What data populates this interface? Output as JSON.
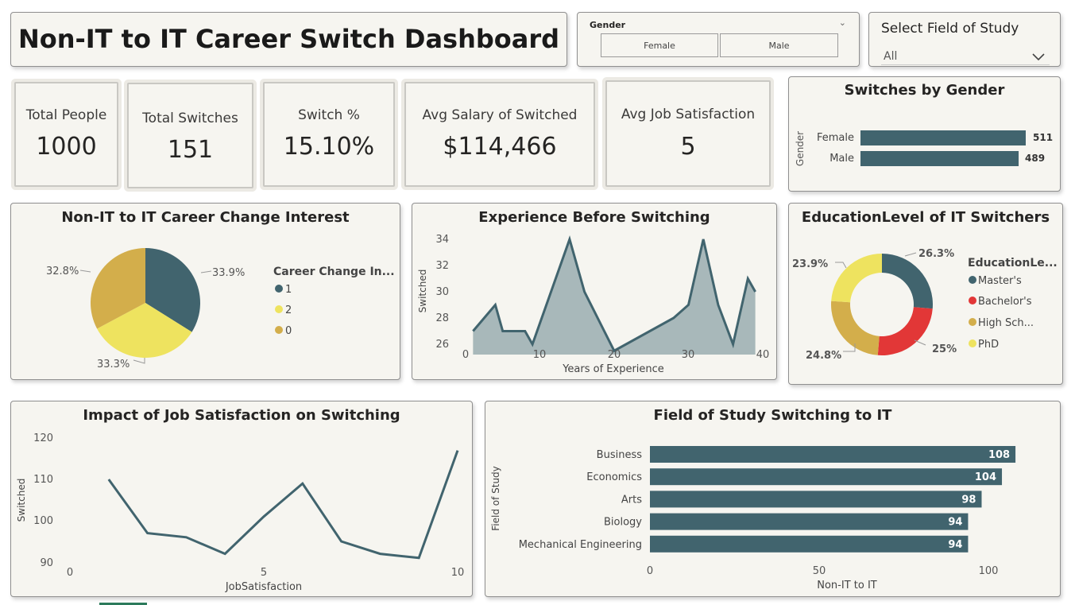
{
  "title": "Non-IT to IT Career Switch Dashboard",
  "gender_slicer": {
    "label": "Gender",
    "options": [
      "Female",
      "Male"
    ]
  },
  "field_slicer": {
    "label": "Select Field of Study",
    "value": "All"
  },
  "kpis": [
    {
      "label": "Total People",
      "value": "1000"
    },
    {
      "label": "Total Switches",
      "value": "151"
    },
    {
      "label": "Switch %",
      "value": "15.10%"
    },
    {
      "label": "Avg Salary of Switched",
      "value": "$114,466"
    },
    {
      "label": "Avg Job Satisfaction",
      "value": "5"
    }
  ],
  "colors": {
    "teal": "#41646e",
    "yellow": "#eee35f",
    "gold": "#d3ae4b",
    "red": "#e23737",
    "area": "#a8b8ba"
  },
  "gender_chart": {
    "title": "Switches by Gender",
    "axis_label": "Gender",
    "chart_data": {
      "type": "bar",
      "categories": [
        "Female",
        "Male"
      ],
      "values": [
        511,
        489
      ],
      "labels": [
        "511",
        "489"
      ]
    }
  },
  "interest_chart": {
    "title": "Non-IT to IT Career Change Interest",
    "legend_title": "Career Change In...",
    "chart_data": {
      "type": "pie",
      "categories": [
        "1",
        "2",
        "0"
      ],
      "values": [
        33.9,
        33.3,
        32.8
      ],
      "labels": [
        "33.9%",
        "33.3%",
        "32.8%"
      ],
      "colors": [
        "#41646e",
        "#eee35f",
        "#d3ae4b"
      ]
    }
  },
  "experience_chart": {
    "title": "Experience Before Switching",
    "xlabel": "Years of Experience",
    "ylabel": "Switched",
    "x_ticks": [
      "0",
      "10",
      "20",
      "30",
      "40"
    ],
    "y_ticks": [
      "26",
      "28",
      "30",
      "32",
      "34"
    ],
    "chart_data": {
      "type": "area",
      "xlim": [
        0,
        40
      ],
      "ylim": [
        26,
        35
      ],
      "x": [
        1,
        4,
        5,
        8,
        9,
        14,
        16,
        20,
        28,
        30,
        32,
        34,
        36,
        38,
        39
      ],
      "y": [
        27,
        29,
        27,
        27,
        26,
        34,
        30,
        25.5,
        28,
        29,
        34,
        29,
        26,
        31,
        30
      ]
    }
  },
  "education_chart": {
    "title": "EducationLevel of IT Switchers",
    "legend_title": "EducationLe...",
    "legend": [
      "Master's",
      "Bachelor's",
      "High Sch...",
      "PhD"
    ],
    "chart_data": {
      "type": "pie",
      "categories": [
        "Master's",
        "Bachelor's",
        "High Sch...",
        "PhD"
      ],
      "values": [
        26.3,
        25,
        24.8,
        23.9
      ],
      "labels": [
        "26.3%",
        "25%",
        "24.8%",
        "23.9%"
      ],
      "colors": [
        "#41646e",
        "#e23737",
        "#d3ae4b",
        "#eee35f"
      ]
    }
  },
  "satisfaction_chart": {
    "title": "Impact of Job Satisfaction on Switching",
    "xlabel": "JobSatisfaction",
    "ylabel": "Switched",
    "x_ticks": [
      "0",
      "5",
      "10"
    ],
    "y_ticks": [
      "90",
      "100",
      "110",
      "120"
    ],
    "chart_data": {
      "type": "line",
      "xlim": [
        0,
        10
      ],
      "ylim": [
        88,
        122
      ],
      "x": [
        1,
        2,
        3,
        4,
        5,
        6,
        7,
        8,
        9,
        10
      ],
      "y": [
        110,
        97,
        96,
        92,
        101,
        109,
        95,
        92,
        91,
        117
      ]
    }
  },
  "field_chart": {
    "title": "Field of Study Switching to IT",
    "xlabel": "Non-IT to IT",
    "ylabel": "Field of Study",
    "x_ticks": [
      "0",
      "50",
      "100"
    ],
    "chart_data": {
      "type": "bar",
      "categories": [
        "Business",
        "Economics",
        "Arts",
        "Biology",
        "Mechanical Engineering"
      ],
      "values": [
        108,
        104,
        98,
        94,
        94
      ],
      "labels": [
        "108",
        "104",
        "98",
        "94",
        "94"
      ],
      "xlim": [
        0,
        100
      ]
    }
  }
}
